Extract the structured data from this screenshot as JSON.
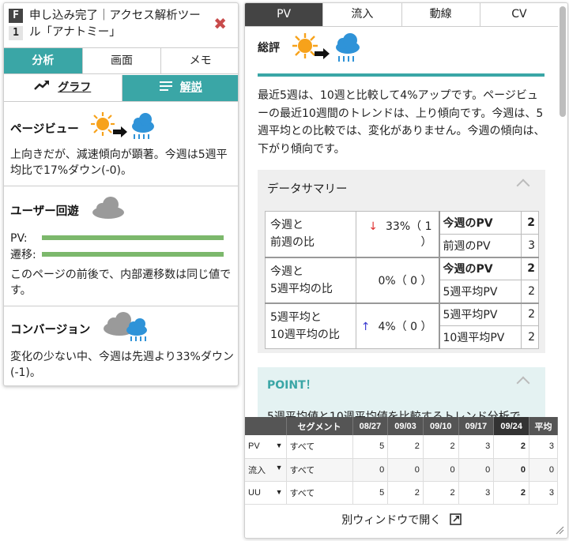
{
  "left_panel": {
    "badge_f": "F",
    "badge_num": "1",
    "title": "申し込み完了｜アクセス解析ツール「アナトミー」",
    "close_glyph": "✖",
    "tabs": [
      {
        "label": "分析",
        "active": true
      },
      {
        "label": "画面",
        "active": false
      },
      {
        "label": "メモ",
        "active": false
      }
    ],
    "subtabs": [
      {
        "label": "グラフ",
        "icon": "trend-icon",
        "active": false
      },
      {
        "label": "解説",
        "icon": "list-icon",
        "active": true
      }
    ],
    "pageview": {
      "title": "ページビュー",
      "icon": "sun-to-rain-icon",
      "text": "上向きだが、減速傾向が顕著。今週は5週平均比で17%ダウン(-0)。"
    },
    "user_flow": {
      "title": "ユーザー回遊",
      "icon": "cloud-icon",
      "pv_label": "PV:",
      "move_label": "遷移:",
      "pv_fraction": 1.0,
      "move_fraction": 1.0,
      "text": "このページの前後で、内部遷移数は同じ値です。"
    },
    "conversion": {
      "title": "コンバージョン",
      "icon": "cloud-rain-icon",
      "text": "変化の少ない中、今週は先週より33%ダウン(-1)。"
    }
  },
  "right_panel": {
    "tabs": [
      {
        "label": "PV",
        "active": true
      },
      {
        "label": "流入",
        "active": false
      },
      {
        "label": "動線",
        "active": false
      },
      {
        "label": "CV",
        "active": false
      }
    ],
    "sohyo": {
      "title": "総評",
      "text": "最近5週は、10週と比較して4%アップです。ページビューの最近10週間のトレンドは、上り傾向です。今週は、5週平均との比較では、変化がありません。今週の傾向は、下がり傾向です。"
    },
    "summary": {
      "title": "データサマリー",
      "groups": [
        {
          "label": "今週と\n前週の比",
          "arrow": "↓",
          "value": "33%（ 1 ）",
          "rows": [
            {
              "name": "今週のPV",
              "num": "2",
              "bold": true
            },
            {
              "name": "前週のPV",
              "num": "3",
              "bold": false
            }
          ]
        },
        {
          "label": "今週と\n5週平均の比",
          "arrow": "",
          "value": "0%（ 0 ）",
          "rows": [
            {
              "name": "今週のPV",
              "num": "2",
              "bold": true
            },
            {
              "name": "5週平均PV",
              "num": "2",
              "bold": false
            }
          ]
        },
        {
          "label": "5週平均と\n10週平均の比",
          "arrow": "↑",
          "value": "4%（ 0 ）",
          "rows": [
            {
              "name": "5週平均PV",
              "num": "2",
              "bold": false
            },
            {
              "name": "10週平均PV",
              "num": "2",
              "bold": false
            }
          ]
        }
      ]
    },
    "point": {
      "title": "POINT！",
      "text": "5週平均値と10週平均値を比較するトレンド分析で"
    },
    "bottom_table": {
      "headers": [
        "",
        "セグメント",
        "08/27",
        "09/03",
        "09/10",
        "09/17",
        "09/24",
        "平均"
      ],
      "rows": [
        {
          "metric": "PV",
          "segment": "すべて",
          "values": [
            "5",
            "2",
            "2",
            "3",
            "2",
            "3"
          ]
        },
        {
          "metric": "流入",
          "segment": "すべて",
          "values": [
            "0",
            "0",
            "0",
            "0",
            "0",
            "0"
          ]
        },
        {
          "metric": "UU",
          "segment": "すべて",
          "values": [
            "5",
            "2",
            "2",
            "3",
            "2",
            "3"
          ]
        }
      ]
    },
    "new_window_label": "別ウィンドウで開く"
  },
  "colors": {
    "teal": "#3aa6a6",
    "dark_tab": "#444444",
    "bar_green": "#7cb86c",
    "close_red": "#c84b4b",
    "sun_orange": "#f7a21b",
    "rain_blue": "#2f93d8"
  }
}
